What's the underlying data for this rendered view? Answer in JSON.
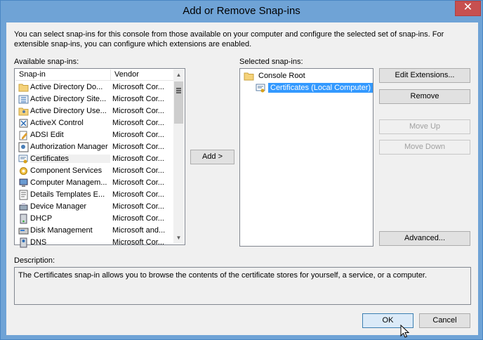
{
  "window": {
    "title": "Add or Remove Snap-ins",
    "close_glyph": "✕"
  },
  "intro": "You can select snap-ins for this console from those available on your computer and configure the selected set of snap-ins. For extensible snap-ins, you can configure which extensions are enabled.",
  "available": {
    "label": "Available snap-ins:",
    "columns": [
      "Snap-in",
      "Vendor"
    ],
    "items": [
      {
        "name": "Active Directory Do...",
        "vendor": "Microsoft Cor...",
        "icon": "folder-icon"
      },
      {
        "name": "Active Directory Site...",
        "vendor": "Microsoft Cor...",
        "icon": "sites-icon"
      },
      {
        "name": "Active Directory Use...",
        "vendor": "Microsoft Cor...",
        "icon": "folder-users-icon"
      },
      {
        "name": "ActiveX Control",
        "vendor": "Microsoft Cor...",
        "icon": "activex-icon"
      },
      {
        "name": "ADSI Edit",
        "vendor": "Microsoft Cor...",
        "icon": "adsi-edit-icon"
      },
      {
        "name": "Authorization Manager",
        "vendor": "Microsoft Cor...",
        "icon": "authorization-icon"
      },
      {
        "name": "Certificates",
        "vendor": "Microsoft Cor...",
        "icon": "certificate-icon"
      },
      {
        "name": "Component Services",
        "vendor": "Microsoft Cor...",
        "icon": "component-services-icon"
      },
      {
        "name": "Computer Managem...",
        "vendor": "Microsoft Cor...",
        "icon": "computer-management-icon"
      },
      {
        "name": "Details Templates E...",
        "vendor": "Microsoft Cor...",
        "icon": "templates-icon"
      },
      {
        "name": "Device Manager",
        "vendor": "Microsoft Cor...",
        "icon": "device-manager-icon"
      },
      {
        "name": "DHCP",
        "vendor": "Microsoft Cor...",
        "icon": "dhcp-icon"
      },
      {
        "name": "Disk Management",
        "vendor": "Microsoft and...",
        "icon": "disk-management-icon"
      },
      {
        "name": "DNS",
        "vendor": "Microsoft Cor...",
        "icon": "dns-icon"
      }
    ]
  },
  "add_button": "Add >",
  "selected": {
    "label": "Selected snap-ins:",
    "root": "Console Root",
    "child": "Certificates (Local Computer)"
  },
  "side_buttons": {
    "edit_extensions": "Edit Extensions...",
    "remove": "Remove",
    "move_up": "Move Up",
    "move_down": "Move Down",
    "advanced": "Advanced..."
  },
  "description": {
    "label": "Description:",
    "text": "The Certificates snap-in allows you to browse the contents of the certificate stores for yourself, a service, or a computer."
  },
  "footer": {
    "ok": "OK",
    "cancel": "Cancel"
  }
}
